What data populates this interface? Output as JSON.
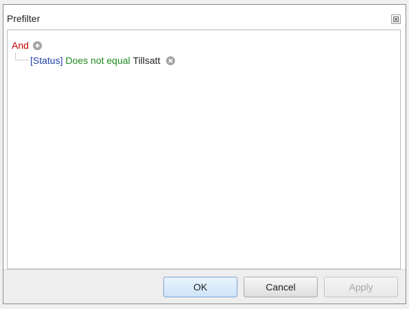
{
  "window": {
    "title": "Prefilter"
  },
  "filter": {
    "group_operator": "And",
    "conditions": [
      {
        "field": "[Status]",
        "operator": "Does not equal",
        "value": "Tillsatt"
      }
    ]
  },
  "buttons": {
    "ok_label": "OK",
    "cancel_label": "Cancel",
    "apply_label": "Apply",
    "apply_enabled": false
  },
  "icons": {
    "close": "close-icon",
    "add_condition": "plus-circle-icon",
    "remove_condition": "x-circle-icon"
  },
  "colors": {
    "group_operator": "#c30000",
    "field": "#1f3fa8",
    "operator": "#1c8a1c",
    "value": "#1e1e1e"
  }
}
